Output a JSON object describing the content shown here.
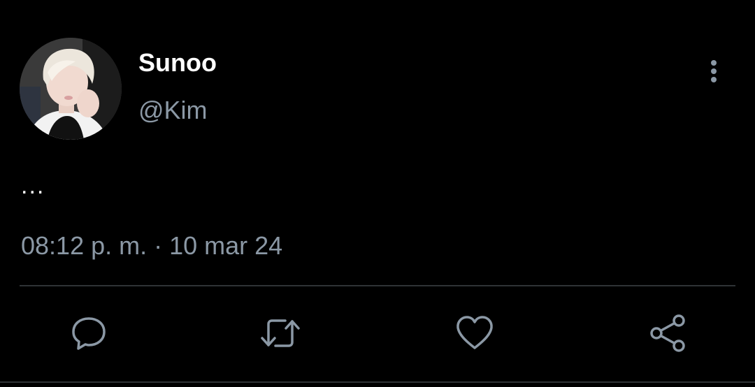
{
  "tweet": {
    "author": {
      "display_name": "Sunoo",
      "handle": "@Kim",
      "avatar_icon": "avatar-photo"
    },
    "text": "...",
    "timestamp": "08:12 p. m. · 10 mar 24",
    "more_icon": "more-vertical-icon"
  },
  "actions": [
    {
      "name": "reply",
      "icon": "comment-icon"
    },
    {
      "name": "retweet",
      "icon": "retweet-icon"
    },
    {
      "name": "like",
      "icon": "heart-icon"
    },
    {
      "name": "share",
      "icon": "share-icon"
    }
  ],
  "colors": {
    "background": "#000000",
    "primary_text": "#ffffff",
    "secondary_text": "#8b98a5",
    "divider": "#2f3336"
  }
}
